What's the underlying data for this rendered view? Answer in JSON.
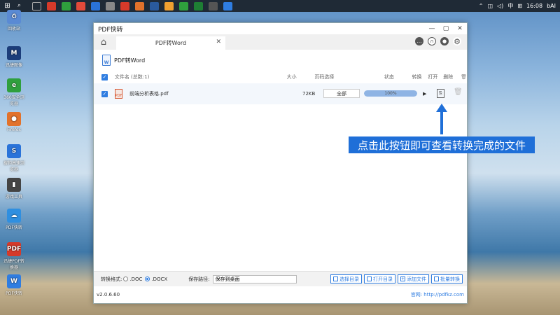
{
  "taskbar": {
    "time": "16:08",
    "ime": "中",
    "right_text": "bAI"
  },
  "desktop_icons": [
    {
      "label": "回收站",
      "color": "#5a8ad4",
      "glyph": "♻"
    },
    {
      "label": "迅捷图像",
      "color": "#1c3d7a",
      "glyph": "M"
    },
    {
      "label": "360安全浏览器",
      "color": "#2f9f3d",
      "glyph": "e"
    },
    {
      "label": "Firefox",
      "color": "#e2722b",
      "glyph": "●"
    },
    {
      "label": "搜狗高速浏览器",
      "color": "#2a73d9",
      "glyph": "S"
    },
    {
      "label": "游戏工具",
      "color": "#444",
      "glyph": "▮"
    },
    {
      "label": "PDF快转",
      "color": "#2f8fe0",
      "glyph": "☁"
    },
    {
      "label": "迅捷PDF转换器",
      "color": "#d63a2a",
      "glyph": "PDF"
    },
    {
      "label": "PDF快转",
      "color": "#2f7de1",
      "glyph": "W"
    }
  ],
  "window": {
    "title": "PDF快转",
    "tab_label": "PDF转Word",
    "subheader_title": "PDF转Word",
    "columns": {
      "filename": "文件名 (总数:1)",
      "size": "大小",
      "pages": "页码选择",
      "status": "状态",
      "convert": "转换",
      "open": "打开",
      "delete": "删除"
    },
    "rows": [
      {
        "filename": "前端分析表格.pdf",
        "size": "72KB",
        "pages": "全部",
        "progress": "100%",
        "progress_value": 100
      }
    ],
    "footer": {
      "format_label": "转换格式:",
      "format_doc": ".DOC",
      "format_docx": ".DOCX",
      "save_label": "保存路径:",
      "save_value": "保存到桌面",
      "btn_choose": "选择目录",
      "btn_open_dir": "打开目录",
      "btn_add": "添加文件",
      "btn_batch": "批量转换"
    },
    "version": "v2.0.6.60",
    "website": "官网: http://pdfkz.com"
  },
  "annotation": {
    "text": "点击此按钮即可查看转换完成的文件",
    "color": "#1f6fd8"
  }
}
